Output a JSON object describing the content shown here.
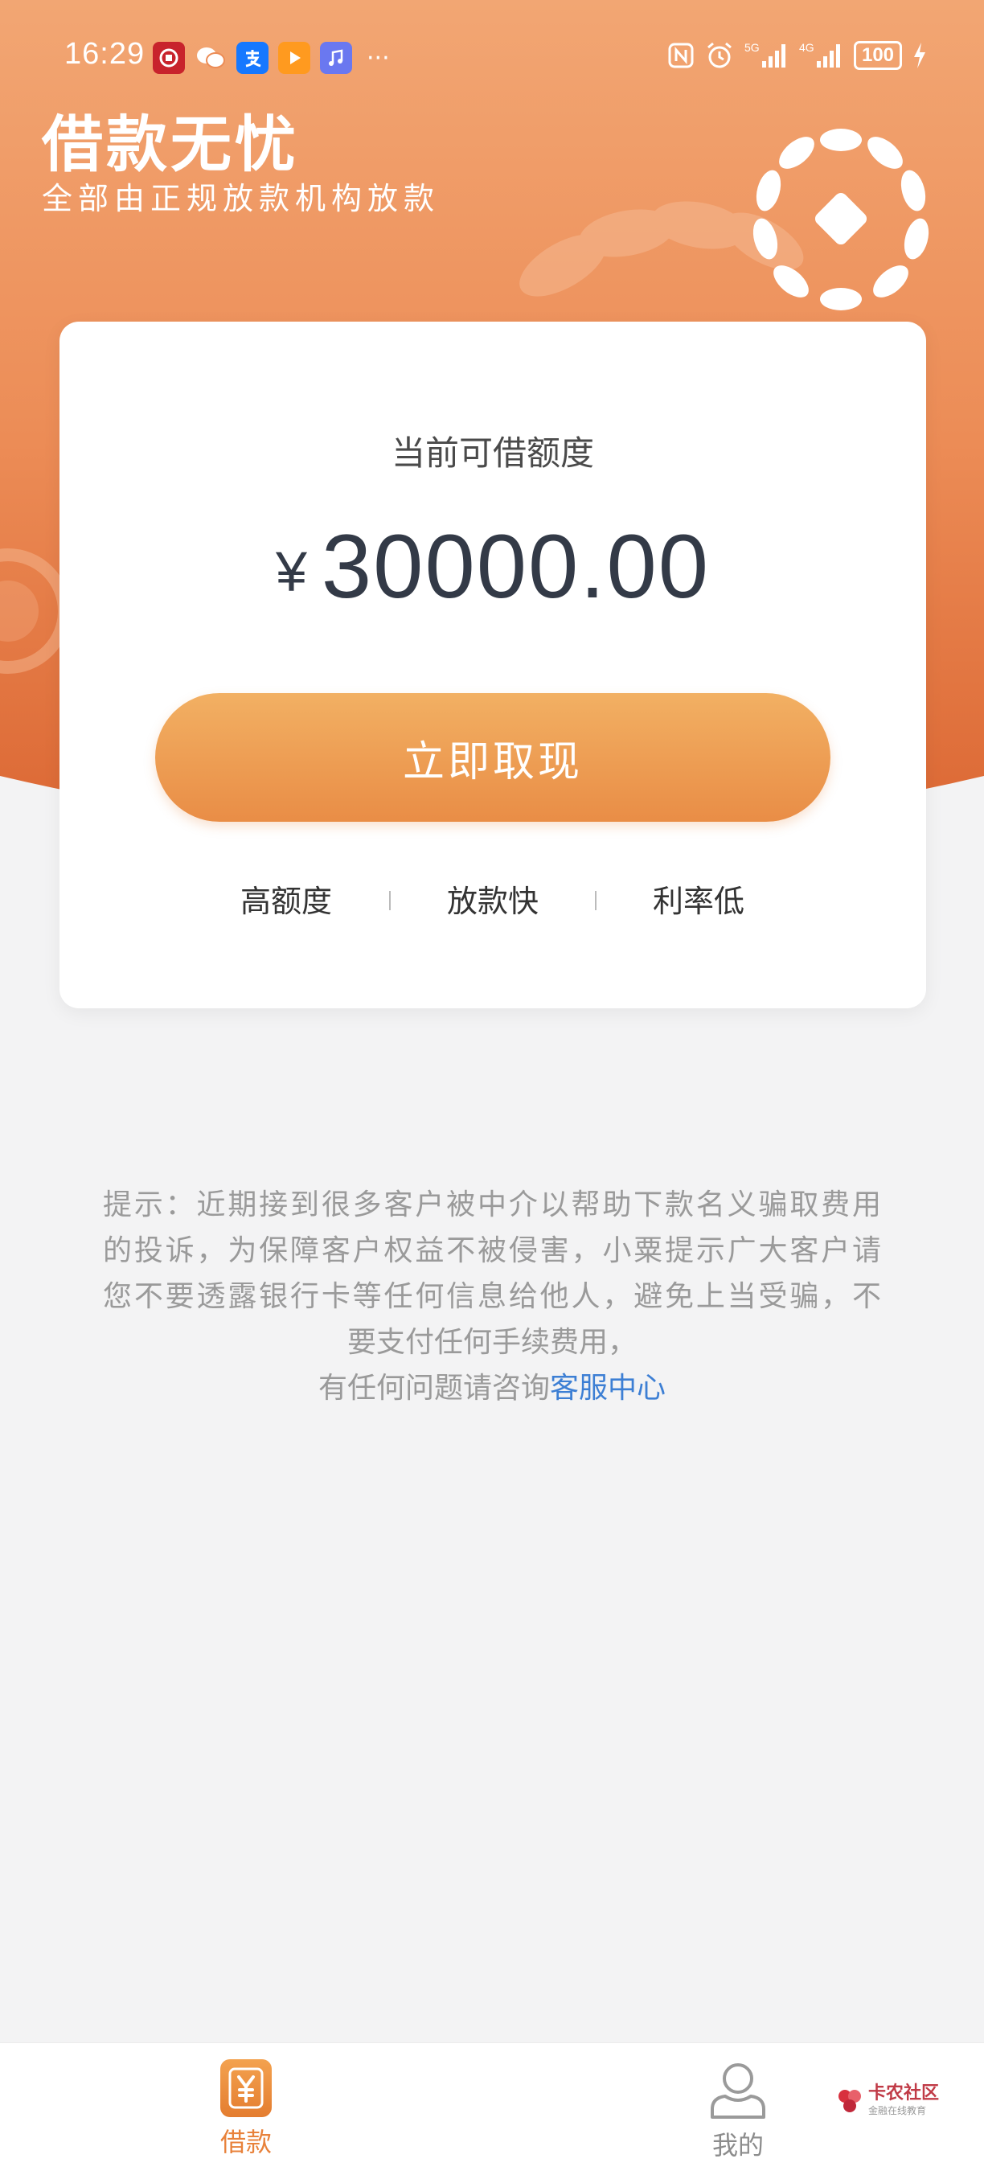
{
  "status_bar": {
    "time": "16:29",
    "battery": "100",
    "network_a": "5G",
    "network_b": "4G",
    "notification_icons": [
      "bank-app-icon",
      "wechat-icon",
      "alipay-icon",
      "video-app-icon",
      "music-app-icon"
    ],
    "more": "···"
  },
  "header": {
    "title": "借款无忧",
    "subtitle": "全部由正规放款机构放款"
  },
  "card": {
    "quota_label": "当前可借额度",
    "currency": "¥",
    "amount": "30000.00",
    "withdraw_label": "立即取现",
    "features": [
      "高额度",
      "放款快",
      "利率低"
    ]
  },
  "notice": {
    "line1": "提示：近期接到很多客户被中介以帮助下款名义骗取费用",
    "line2": "的投诉，为保障客户权益不被侵害，小粟提示广大客户请",
    "line3": "您不要透露银行卡等任何信息给他人，避免上当受骗，不",
    "line4": "要支付任何手续费用，",
    "line5_prefix": "有任何问题请咨询",
    "link": "客服中心"
  },
  "tabs": [
    {
      "label": "借款",
      "active": true,
      "icon": "yuan-icon"
    },
    {
      "label": "我的",
      "active": false,
      "icon": "user-icon"
    }
  ],
  "watermark": {
    "name": "卡农社区",
    "sub": "金融在线教育"
  },
  "colors": {
    "accent": "#e8823b",
    "header_top": "#f2a673",
    "header_bottom": "#dd6a36",
    "link": "#3d7fd4"
  }
}
